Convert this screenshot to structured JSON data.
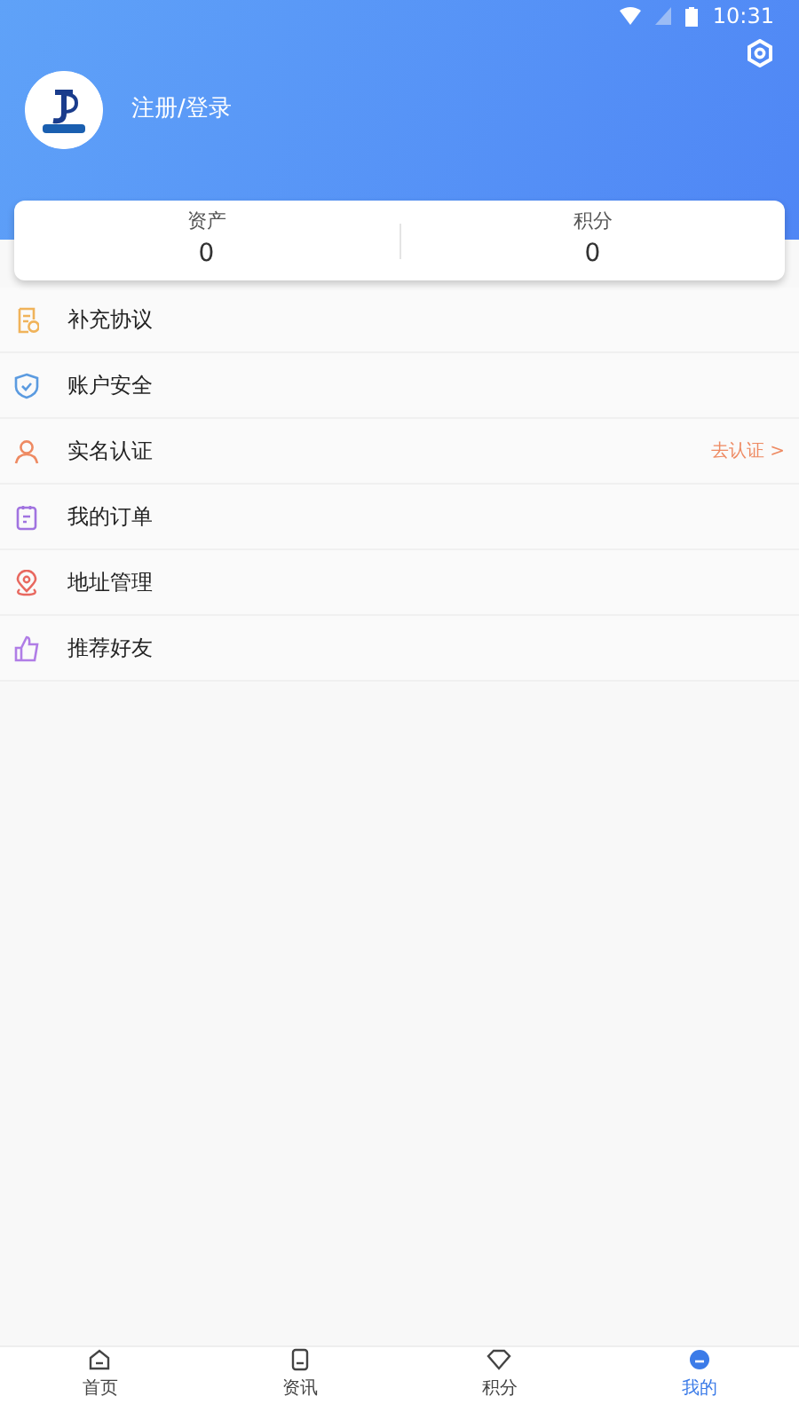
{
  "status_bar": {
    "time": "10:31"
  },
  "profile": {
    "login": "注册/登录"
  },
  "stats": [
    {
      "label": "资产",
      "value": "0"
    },
    {
      "label": "积分",
      "value": "0"
    }
  ],
  "menu": [
    {
      "label": "补充协议",
      "color": "#f0b35a"
    },
    {
      "label": "账户安全",
      "color": "#5b9be0"
    },
    {
      "label": "实名认证",
      "color": "#ee8a62",
      "action": "去认证 >"
    },
    {
      "label": "我的订单",
      "color": "#a173e0"
    },
    {
      "label": "地址管理",
      "color": "#e8685f"
    },
    {
      "label": "推荐好友",
      "color": "#b07de6"
    }
  ],
  "tabbar": [
    {
      "label": "首页",
      "selected": false
    },
    {
      "label": "资讯",
      "selected": false
    },
    {
      "label": "积分",
      "selected": false
    },
    {
      "label": "我的",
      "selected": true
    }
  ]
}
